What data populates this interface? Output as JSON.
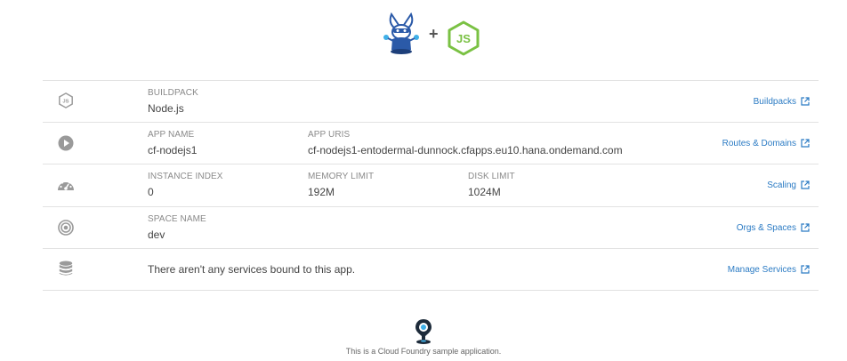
{
  "header": {
    "bunny_logo": "bunny-mascot-icon",
    "plus": "+",
    "js_logo": "nodejs-icon"
  },
  "rows": {
    "buildpack": {
      "icon": "nodejs-icon",
      "label": "BUILDPACK",
      "value": "Node.js",
      "link": "Buildpacks"
    },
    "app": {
      "icon": "play-icon",
      "name_label": "APP NAME",
      "name_value": "cf-nodejs1",
      "uris_label": "APP URIS",
      "uris_value": "cf-nodejs1-entodermal-dunnock.cfapps.eu10.hana.ondemand.com",
      "link": "Routes & Domains"
    },
    "instance": {
      "icon": "speedometer-icon",
      "index_label": "INSTANCE INDEX",
      "index_value": "0",
      "memory_label": "MEMORY LIMIT",
      "memory_value": "192M",
      "disk_label": "DISK LIMIT",
      "disk_value": "1024M",
      "link": "Scaling"
    },
    "space": {
      "icon": "target-icon",
      "label": "SPACE NAME",
      "value": "dev",
      "link": "Orgs & Spaces"
    },
    "services": {
      "icon": "database-icon",
      "text": "There aren't any services bound to this app.",
      "link": "Manage Services"
    }
  },
  "footer": {
    "icon": "location-pin-icon",
    "text": "This is a Cloud Foundry sample application."
  },
  "colors": {
    "link": "#2b7bc4",
    "icon_gray": "#9a9a9a",
    "divider": "#e2e2e2",
    "js_green": "#7ac143",
    "bunny_blue": "#2b5aa8"
  }
}
